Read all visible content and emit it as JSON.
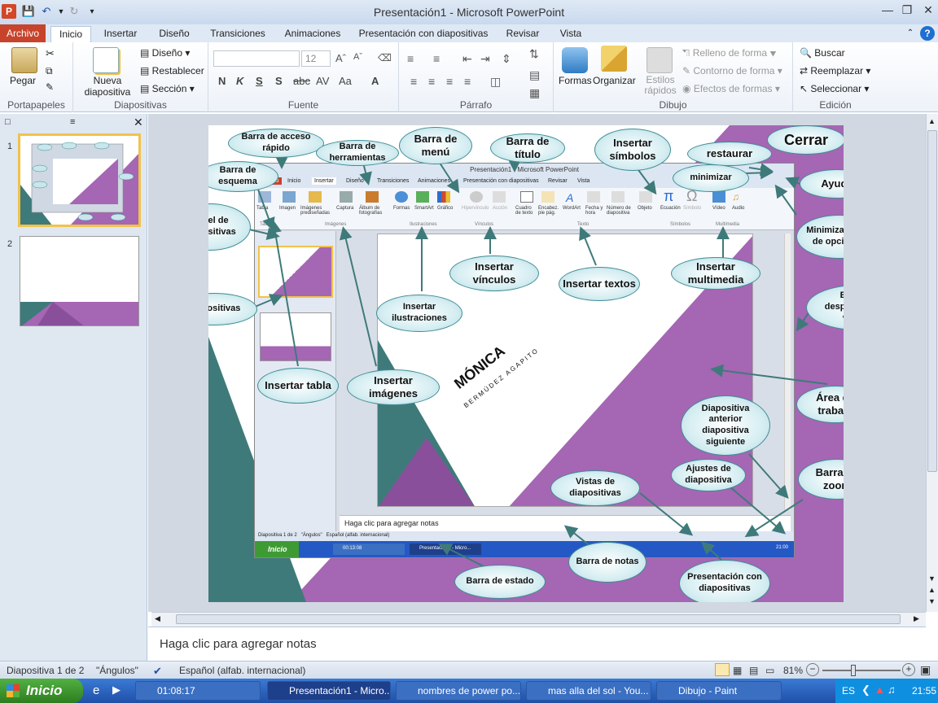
{
  "window": {
    "title": "Presentación1 - Microsoft PowerPoint"
  },
  "tabs": [
    "Archivo",
    "Inicio",
    "Insertar",
    "Diseño",
    "Transiciones",
    "Animaciones",
    "Presentación con diapositivas",
    "Revisar",
    "Vista"
  ],
  "ribbon": {
    "portapapeles": {
      "paste": "Pegar",
      "label": "Portapapeles"
    },
    "diapositivas": {
      "new_slide": "Nueva diapositiva",
      "layout": "Diseño",
      "reset": "Restablecer",
      "section": "Sección",
      "label": "Diapositivas"
    },
    "fuente": {
      "size": "12",
      "label": "Fuente"
    },
    "parrafo": {
      "label": "Párrafo"
    },
    "dibujo": {
      "shapes": "Formas",
      "arrange": "Organizar",
      "quick_styles": "Estilos rápidos",
      "fill": "Relleno de forma",
      "outline": "Contorno de forma",
      "effects": "Efectos de formas",
      "label": "Dibujo"
    },
    "edicion": {
      "find": "Buscar",
      "replace": "Reemplazar",
      "select": "Seleccionar",
      "label": "Edición"
    }
  },
  "thumbs": [
    "1",
    "2"
  ],
  "notes_placeholder": "Haga clic para agregar notas",
  "status": {
    "slide": "Diapositiva 1 de 2",
    "theme": "\"Ángulos\"",
    "lang": "Español (alfab. internacional)",
    "zoom": "81%",
    "zoom_level": 0.81
  },
  "taskbar": {
    "start": "Inicio",
    "clock_app": "01:08:17",
    "items": [
      "Presentación1 - Micro...",
      "nombres de power po...",
      "mas alla del sol - You...",
      "Dibujo - Paint"
    ],
    "lang": "ES",
    "time": "21:55"
  },
  "slide": {
    "name_title": "MÓNICA",
    "name_sub": "BERMÚDEZ AGAPITO",
    "inner_title": "Presentación1 - Microsoft PowerPoint",
    "inner_notes": "Haga clic para agregar notas",
    "inner_tabs": [
      "Archivo",
      "Inicio",
      "Insertar",
      "Diseño",
      "Transiciones",
      "Animaciones",
      "Presentación con diapositivas",
      "Revisar",
      "Vista"
    ],
    "inner_status": "Diapositiva 1 de 2   \"Ángulos\"   Español (alfab. internacional)",
    "inner_start": "Inicio",
    "inner_time1": "00:13:08",
    "inner_task": "Presentación1 - Micro...",
    "inner_time2": "21:00",
    "inner_ribbon": [
      "Tabla",
      "Imagen",
      "Imágenes prediseñadas",
      "Captura",
      "Álbum de fotografías",
      "Formas",
      "SmartArt",
      "Gráfico",
      "Hipervínculo",
      "Acción",
      "Cuadro de texto",
      "Encabez. pie pág.",
      "WordArt",
      "Fecha y hora",
      "Número de diapositiva",
      "Objeto",
      "Ecuación",
      "Símbolo",
      "Vídeo",
      "Audio"
    ],
    "inner_groups": [
      "Tablas",
      "Imágenes",
      "Ilustraciones",
      "Vínculos",
      "Texto",
      "Símbolos",
      "Multimedia"
    ],
    "callouts": [
      "Barra de acceso rápido",
      "Barra de herramientas",
      "Barra de menú",
      "Barra de título",
      "Insertar símbolos",
      "Cerrar",
      "restaurar",
      "minimizar",
      "Ayuda",
      "Barra de esquema",
      "Panel de diapositivas",
      "Minimizar cinta de opciones",
      "Insertar vínculos",
      "Insertar textos",
      "Insertar multimedia",
      "Insertar ilustraciones",
      "Barra de desplazamiento vertical",
      "Diapositivas",
      "Insertar tabla",
      "Insertar imágenes",
      "Área de trabajo",
      "Diapositiva anterior diapositiva siguiente",
      "Ajustes de diapositiva",
      "Barra de zoom",
      "Vistas de diapositivas",
      "Barra de notas",
      "Barra de estado",
      "Presentación con diapositivas"
    ]
  }
}
